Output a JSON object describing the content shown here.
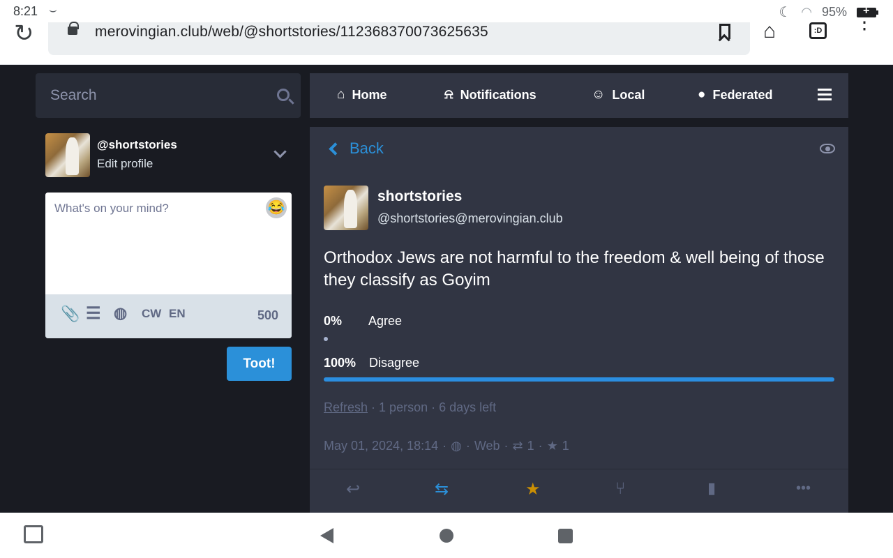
{
  "status_bar": {
    "time": "8:21",
    "battery": "95%"
  },
  "browser": {
    "url": "merovingian.club/web/@shortstories/112368370073625635",
    "tabs_label": ":D"
  },
  "search": {
    "placeholder": "Search"
  },
  "account": {
    "handle": "@shortstories",
    "edit_profile": "Edit profile"
  },
  "compose": {
    "placeholder": "What's on your mind?",
    "cw_label": "CW",
    "lang_label": "EN",
    "char_count": "500",
    "submit_label": "Toot!"
  },
  "nav": {
    "home": "Home",
    "notifications": "Notifications",
    "local": "Local",
    "federated": "Federated"
  },
  "detail": {
    "back_label": "Back"
  },
  "post": {
    "display_name": "shortstories",
    "handle": "@shortstories@merovingian.club",
    "content": "Orthodox Jews are not harmful to the freedom & well being of those they classify as Goyim",
    "poll": {
      "options": [
        {
          "percent": "0%",
          "label": "Agree",
          "fraction": 0
        },
        {
          "percent": "100%",
          "label": "Disagree",
          "fraction": 1
        }
      ],
      "refresh_label": "Refresh",
      "voters": "1 person",
      "time_left": "6 days left"
    },
    "date": "May 01, 2024, 18:14",
    "application": "Web",
    "boost_count": "1",
    "favourite_count": "1"
  },
  "colors": {
    "accent": "#2b90d9",
    "favourite": "#ca8f04",
    "panel": "#313543",
    "background": "#191b22"
  }
}
